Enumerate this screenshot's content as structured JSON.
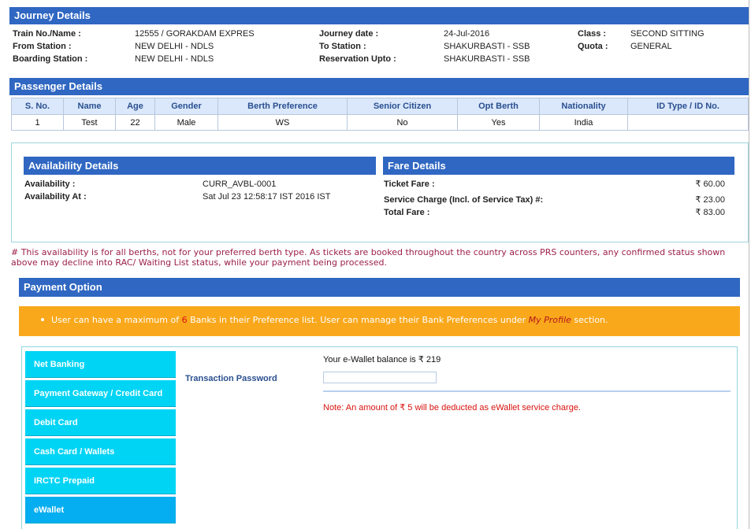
{
  "journey": {
    "header": "Journey Details",
    "train_label": "Train No./Name :",
    "train_value": "12555 / GORAKDAM EXPRES",
    "from_label": "From Station :",
    "from_value": "NEW DELHI - NDLS",
    "boarding_label": "Boarding Station :",
    "boarding_value": "NEW DELHI - NDLS",
    "date_label": "Journey date :",
    "date_value": "24-Jul-2016",
    "to_label": "To Station :",
    "to_value": "SHAKURBASTI - SSB",
    "upto_label": "Reservation Upto :",
    "upto_value": "SHAKURBASTI - SSB",
    "class_label": "Class :",
    "class_value": "SECOND SITTING",
    "quota_label": "Quota :",
    "quota_value": "GENERAL"
  },
  "passenger": {
    "header": "Passenger Details",
    "columns": [
      "S. No.",
      "Name",
      "Age",
      "Gender",
      "Berth Preference",
      "Senior Citizen",
      "Opt Berth",
      "Nationality",
      "ID Type / ID No."
    ],
    "rows": [
      [
        "1",
        "Test",
        "22",
        "Male",
        "WS",
        "No",
        "Yes",
        "India",
        ""
      ]
    ]
  },
  "availability": {
    "header": "Availability Details",
    "avail_label": "Availability :",
    "avail_value": "CURR_AVBL-0001",
    "at_label": "Availability At :",
    "at_value": "Sat Jul 23 12:58:17 IST 2016 IST"
  },
  "fare": {
    "header": "Fare Details",
    "ticket_label": "Ticket Fare :",
    "ticket_value": "₹ 60.00",
    "service_label": "Service Charge (Incl. of Service Tax) #:",
    "service_value": "₹ 23.00",
    "total_label": "Total Fare :",
    "total_value": "₹ 83.00"
  },
  "notice": "# This availability is for all berths, not for your preferred berth type. As tickets are booked throughout the country across PRS counters, any confirmed status shown above may decline into RAC/ Waiting List status, while your payment being processed.",
  "payment": {
    "header": "Payment Option",
    "banner_pre": "User can have a maximum of ",
    "banner_num": "6",
    "banner_mid": " Banks in their Preference list. User can manage their Bank Preferences under ",
    "banner_link": "My Profile",
    "banner_post": " section.",
    "methods": [
      "Net Banking",
      "Payment Gateway / Credit Card",
      "Debit Card",
      "Cash Card / Wallets",
      "IRCTC Prepaid",
      "eWallet"
    ],
    "active_method": "eWallet",
    "balance_text": "Your e-Wallet balance is ₹ 219",
    "password_label": "Transaction Password",
    "password_value": "",
    "charge_note": "Note: An amount of ₹ 5 will be deducted as eWallet service charge."
  },
  "colors": {
    "header_blue": "#2f67c2",
    "banner_orange": "#f9a81c",
    "method_cyan": "#00d4f5",
    "method_active": "#05aef0",
    "note_red": "#d8130f"
  }
}
